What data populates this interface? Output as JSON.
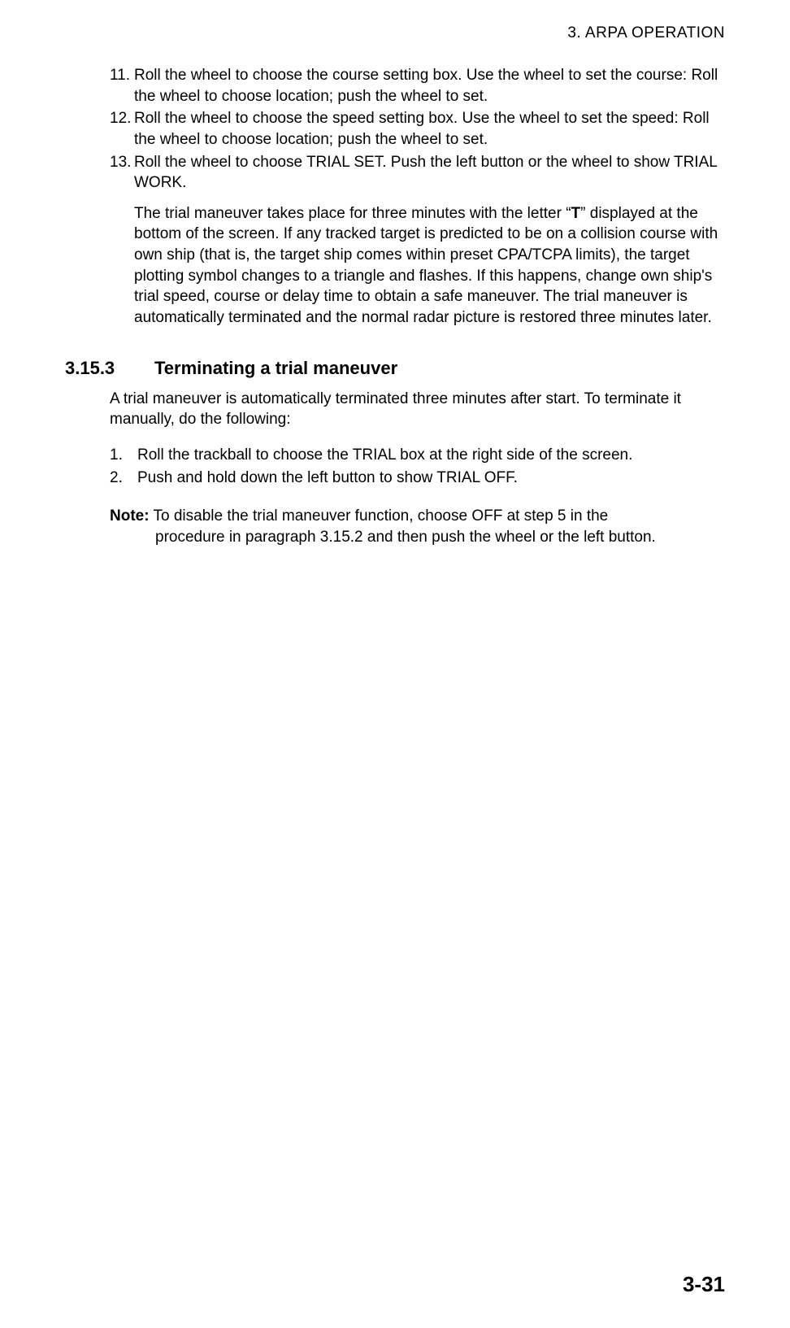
{
  "header": "3.  ARPA  OPERATION",
  "list1": {
    "items": [
      {
        "num": "11.",
        "text": "Roll the wheel to choose the course setting box. Use the wheel to set the course: Roll the wheel to choose location; push the wheel to set."
      },
      {
        "num": "12.",
        "text": "Roll the wheel to choose the speed setting box. Use the wheel to set the speed: Roll the wheel to choose location; push the wheel to set."
      },
      {
        "num": "13.",
        "text": "Roll the wheel to choose TRIAL SET. Push the left button or the wheel to show TRIAL WORK."
      }
    ]
  },
  "para1_pre": "The trial maneuver takes place for three minutes with the letter “",
  "para1_bold": "T",
  "para1_post": "” displayed at the bottom of the screen. If any tracked target is predicted to be on a collision course with own ship (that is, the target ship comes within preset CPA/TCPA limits), the target plotting symbol changes to a triangle and flashes. If this happens, change own ship's trial speed, course or delay time to obtain a safe maneuver. The trial maneuver is automatically terminated and the normal radar picture is restored three minutes later.",
  "section": {
    "num": "3.15.3",
    "title": "Terminating a trial maneuver"
  },
  "intro": "A trial maneuver is automatically terminated three minutes after start. To terminate it manually, do the following:",
  "steps": {
    "items": [
      {
        "num": "1.",
        "text": "Roll the trackball to choose the TRIAL box at the right side of the screen."
      },
      {
        "num": "2.",
        "text": "Push and hold down the left button to show TRIAL OFF."
      }
    ]
  },
  "note": {
    "label": "Note:",
    "line1": " To disable the trial maneuver function, choose OFF at step 5 in the",
    "line2": "procedure in paragraph 3.15.2 and then push the wheel or the left button."
  },
  "footer": "3-31"
}
